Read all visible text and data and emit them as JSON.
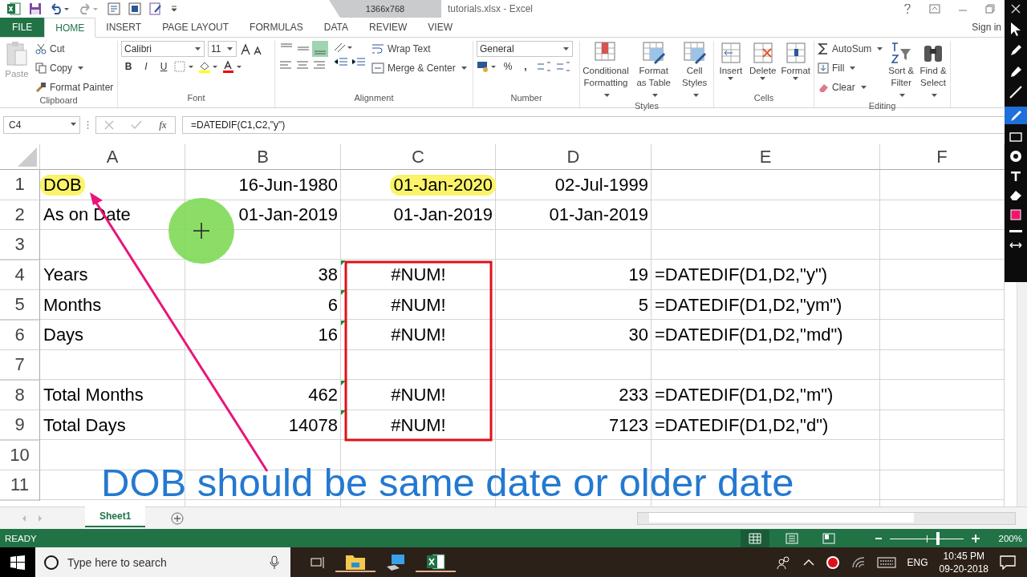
{
  "title_bar": {
    "recorder_size": "1366x768",
    "title": "tutorials.xlsx - Excel"
  },
  "ribbon_tabs": [
    {
      "label": "FILE",
      "selected": false
    },
    {
      "label": "HOME",
      "selected": true
    },
    {
      "label": "INSERT",
      "selected": false
    },
    {
      "label": "PAGE LAYOUT",
      "selected": false
    },
    {
      "label": "FORMULAS",
      "selected": false
    },
    {
      "label": "DATA",
      "selected": false
    },
    {
      "label": "REVIEW",
      "selected": false
    },
    {
      "label": "VIEW",
      "selected": false
    }
  ],
  "account": "Sign in",
  "clipboard": {
    "label": "Clipboard",
    "paste": "Paste",
    "cut": "Cut",
    "copy": "Copy",
    "format_painter": "Format Painter"
  },
  "font": {
    "label": "Font",
    "name": "Calibri",
    "size": "11",
    "bold": "B",
    "italic": "I",
    "underline": "U"
  },
  "alignment": {
    "label": "Alignment",
    "wrap_text": "Wrap Text",
    "merge_center": "Merge & Center"
  },
  "number": {
    "label": "Number",
    "format": "General",
    "percent": "%",
    "comma": ","
  },
  "styles": {
    "label": "Styles",
    "buttons": [
      "Conditional Formatting",
      "Format as Table",
      "Cell Styles"
    ]
  },
  "cells": {
    "label": "Cells",
    "buttons": [
      "Insert",
      "Delete",
      "Format"
    ]
  },
  "editing": {
    "label": "Editing",
    "autosum": "AutoSum",
    "fill": "Fill",
    "clear": "Clear",
    "buttons": [
      "Sort & Filter",
      "Find & Select"
    ]
  },
  "formula_bar": {
    "name_box": "C4",
    "function_label": "fx",
    "formula": "=DATEDIF(C1,C2,\"y\")"
  },
  "sheet": {
    "columns": [
      "A",
      "B",
      "C",
      "D",
      "E",
      "F"
    ],
    "rows": [
      {
        "number": "1",
        "cells": {
          "a": {
            "kind": "text",
            "text": "DOB",
            "highlighted": true
          },
          "b": {
            "kind": "number",
            "text": "16-Jun-1980",
            "highlighted": false
          },
          "c": {
            "kind": "number",
            "text": "01-Jan-2020",
            "highlighted": true
          },
          "d": {
            "kind": "number",
            "text": "02-Jul-1999",
            "highlighted": false
          }
        }
      },
      {
        "number": "2",
        "cells": {
          "a": {
            "kind": "text",
            "text": "As on Date",
            "highlighted": false
          },
          "b": {
            "kind": "number",
            "text": "01-Jan-2019",
            "highlighted": false
          },
          "c": {
            "kind": "number",
            "text": "01-Jan-2019",
            "highlighted": false
          },
          "d": {
            "kind": "number",
            "text": "01-Jan-2019",
            "highlighted": false
          }
        }
      },
      {
        "number": "3",
        "cells": {}
      },
      {
        "number": "4",
        "cells": {
          "a": {
            "kind": "text",
            "text": "Years",
            "highlighted": false
          },
          "b": {
            "kind": "number",
            "text": "38",
            "highlighted": false
          },
          "c": {
            "kind": "error",
            "text": "#NUM!",
            "highlighted": false
          },
          "d": {
            "kind": "number",
            "text": "19",
            "highlighted": false
          },
          "e": {
            "kind": "text",
            "text": "=DATEDIF(D1,D2,\"y\")",
            "highlighted": false
          }
        }
      },
      {
        "number": "5",
        "cells": {
          "a": {
            "kind": "text",
            "text": "Months",
            "highlighted": false
          },
          "b": {
            "kind": "number",
            "text": "6",
            "highlighted": false
          },
          "c": {
            "kind": "error",
            "text": "#NUM!",
            "highlighted": false
          },
          "d": {
            "kind": "number",
            "text": "5",
            "highlighted": false
          },
          "e": {
            "kind": "text",
            "text": "=DATEDIF(D1,D2,\"ym\")",
            "highlighted": false
          }
        }
      },
      {
        "number": "6",
        "cells": {
          "a": {
            "kind": "text",
            "text": "Days",
            "highlighted": false
          },
          "b": {
            "kind": "number",
            "text": "16",
            "highlighted": false
          },
          "c": {
            "kind": "error",
            "text": "#NUM!",
            "highlighted": false
          },
          "d": {
            "kind": "number",
            "text": "30",
            "highlighted": false
          },
          "e": {
            "kind": "text",
            "text": "=DATEDIF(D1,D2,\"md\")",
            "highlighted": false
          }
        }
      },
      {
        "number": "7",
        "cells": {}
      },
      {
        "number": "8",
        "cells": {
          "a": {
            "kind": "text",
            "text": "Total Months",
            "highlighted": false
          },
          "b": {
            "kind": "number",
            "text": "462",
            "highlighted": false
          },
          "c": {
            "kind": "error",
            "text": "#NUM!",
            "highlighted": false
          },
          "d": {
            "kind": "number",
            "text": "233",
            "highlighted": false
          },
          "e": {
            "kind": "text",
            "text": "=DATEDIF(D1,D2,\"m\")",
            "highlighted": false
          }
        }
      },
      {
        "number": "9",
        "cells": {
          "a": {
            "kind": "text",
            "text": "Total Days",
            "highlighted": false
          },
          "b": {
            "kind": "number",
            "text": "14078",
            "highlighted": false
          },
          "c": {
            "kind": "error",
            "text": "#NUM!",
            "highlighted": false
          },
          "d": {
            "kind": "number",
            "text": "7123",
            "highlighted": false
          },
          "e": {
            "kind": "text",
            "text": "=DATEDIF(D1,D2,\"d\")",
            "highlighted": false
          }
        }
      },
      {
        "number": "10",
        "cells": {}
      },
      {
        "number": "11",
        "cells": {}
      }
    ]
  },
  "caption": "DOB should be same date or older date",
  "sheet_tabs": [
    {
      "label": "Sheet1",
      "selected": true
    }
  ],
  "status_bar": {
    "mode": "READY",
    "zoom": "200%",
    "level": 0.66
  },
  "taskbar": {
    "search_placeholder": "Type here to search",
    "language": "ENG",
    "time": "10:45 PM",
    "date": "09-20-2018"
  }
}
